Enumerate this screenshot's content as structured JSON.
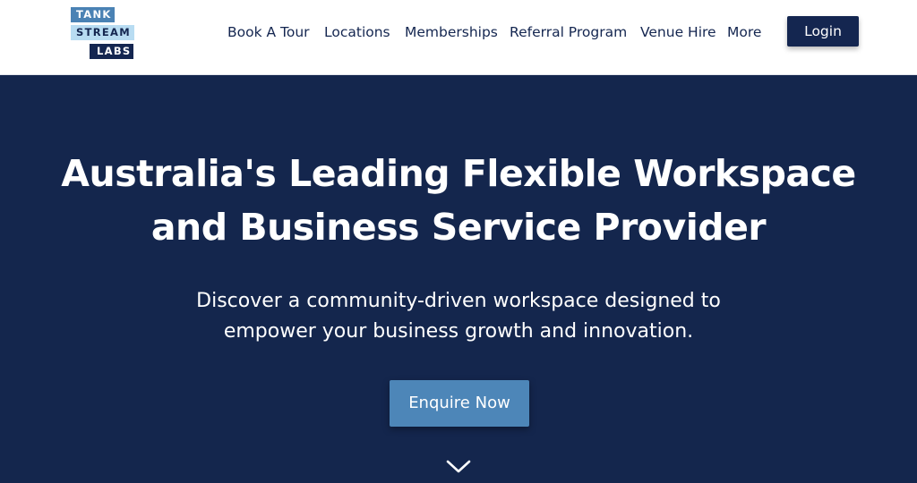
{
  "brand": {
    "logo_lines": [
      "TANK",
      "STREAM",
      "LABS"
    ]
  },
  "nav": {
    "items": [
      "Book A Tour",
      "Locations",
      "Memberships",
      "Referral Program",
      "Venue Hire",
      "More"
    ],
    "login_label": "Login"
  },
  "hero": {
    "headline_line1": "Australia's Leading Flexible Workspace",
    "headline_line2": "and Business Service Provider",
    "subtitle_line1": "Discover a community-driven workspace designed to",
    "subtitle_line2": "empower your business growth and innovation.",
    "cta_label": "Enquire Now",
    "scroll_icon": "chevron-down-icon"
  },
  "colors": {
    "navy": "#14264d",
    "accent_blue": "#4d86b8",
    "light_blue": "#b8dcf2",
    "white": "#ffffff"
  }
}
